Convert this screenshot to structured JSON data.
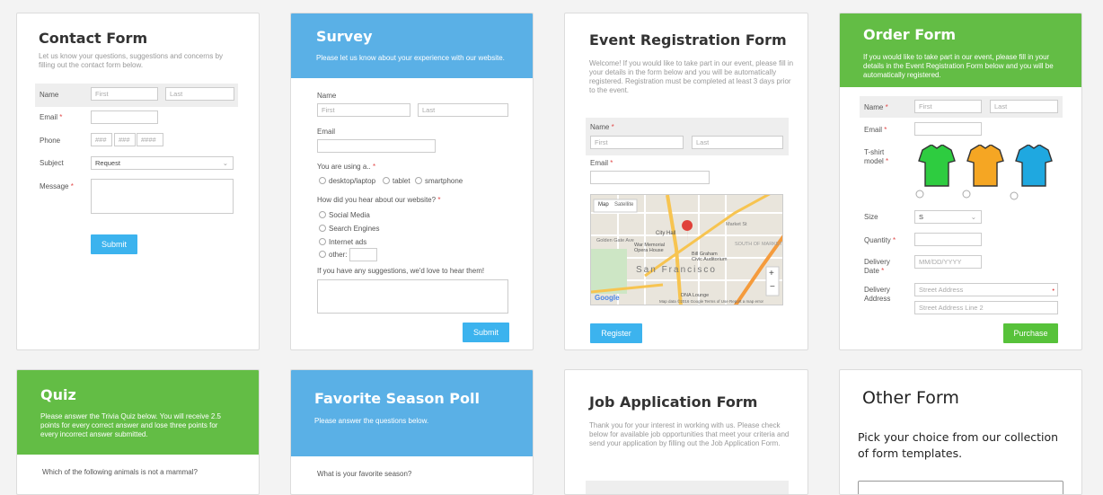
{
  "contact": {
    "title": "Contact Form",
    "desc": "Let us know your questions, suggestions and concerns by filling out the contact form below.",
    "name_label": "Name",
    "first_ph": "First",
    "last_ph": "Last",
    "email_label": "Email",
    "phone_label": "Phone",
    "phone_ph": "###",
    "phone_ph4": "####",
    "subject_label": "Subject",
    "subject_value": "Request",
    "message_label": "Message",
    "submit": "Submit"
  },
  "survey": {
    "title": "Survey",
    "desc": "Please let us know about your experience with our website.",
    "name_label": "Name",
    "first_ph": "First",
    "last_ph": "Last",
    "email_label": "Email",
    "using_label": "You are using a..",
    "using_options": [
      "desktop/laptop",
      "tablet",
      "smartphone"
    ],
    "hear_label": "How did you hear about our website?",
    "hear_options": [
      "Social Media",
      "Search Engines",
      "Internet ads",
      "other:"
    ],
    "suggest_label": "If you have any suggestions, we'd love to hear them!",
    "submit": "Submit"
  },
  "event": {
    "title": "Event Registration Form",
    "desc": "Welcome! If you would like to take part in our event, please fill in your details in the form below and you will be automatically registered. Registration must be completed at least 3 days prior to the event.",
    "name_label": "Name",
    "first_ph": "First",
    "last_ph": "Last",
    "email_label": "Email",
    "map_tab_map": "Map",
    "map_tab_sat": "Satellite",
    "map_city": "San Francisco",
    "map_labels": [
      "City Hall",
      "War Memorial Opera House",
      "Bill Graham Civic Auditorium",
      "SOUTH OF MARKET",
      "Golden Gate Ave",
      "DNA Lounge",
      "Market St"
    ],
    "map_logo": "Google",
    "map_footer": "Map data ©2016 Google   Terms of Use   Report a map error",
    "zoom_in": "+",
    "zoom_out": "−",
    "submit": "Register"
  },
  "order": {
    "title": "Order Form",
    "desc": "If you would like to take part in our event, please fill in your details in the Event Registration Form below and you will be automatically registered.",
    "name_label": "Name",
    "first_ph": "First",
    "last_ph": "Last",
    "email_label": "Email",
    "tshirt_label": "T-shirt model",
    "shirt_colors": [
      "#2ecc40",
      "#f5a623",
      "#1fa8e0"
    ],
    "size_label": "Size",
    "size_value": "S",
    "qty_label": "Quantity",
    "delivery_date_label": "Delivery Date",
    "date_ph": "MM/DD/YYYY",
    "delivery_addr_label": "Delivery Address",
    "street_ph": "Street Address",
    "street2_ph": "Street Address Line 2",
    "submit": "Purchase"
  },
  "quiz": {
    "title": "Quiz",
    "desc": "Please answer the Trivia Quiz below. You will receive 2.5 points for every correct answer and lose three points for every incorrect answer submitted.",
    "question": "Which of the following animals is not a mammal?"
  },
  "poll": {
    "title": "Favorite Season Poll",
    "desc": "Please answer the questions below.",
    "question": "What is your favorite season?"
  },
  "job": {
    "title": "Job Application Form",
    "desc": "Thank you for your interest in working with us. Please check below for available job opportunities that meet your criteria and send your application by filling out the Job Application Form."
  },
  "other": {
    "title": "Other Form",
    "desc": "Pick your choice from our collection of form templates."
  },
  "colors": {
    "blue": "#5ab0e6",
    "green": "#63bd45",
    "button_blue": "#3cb3ee",
    "button_green": "#57c23a"
  }
}
